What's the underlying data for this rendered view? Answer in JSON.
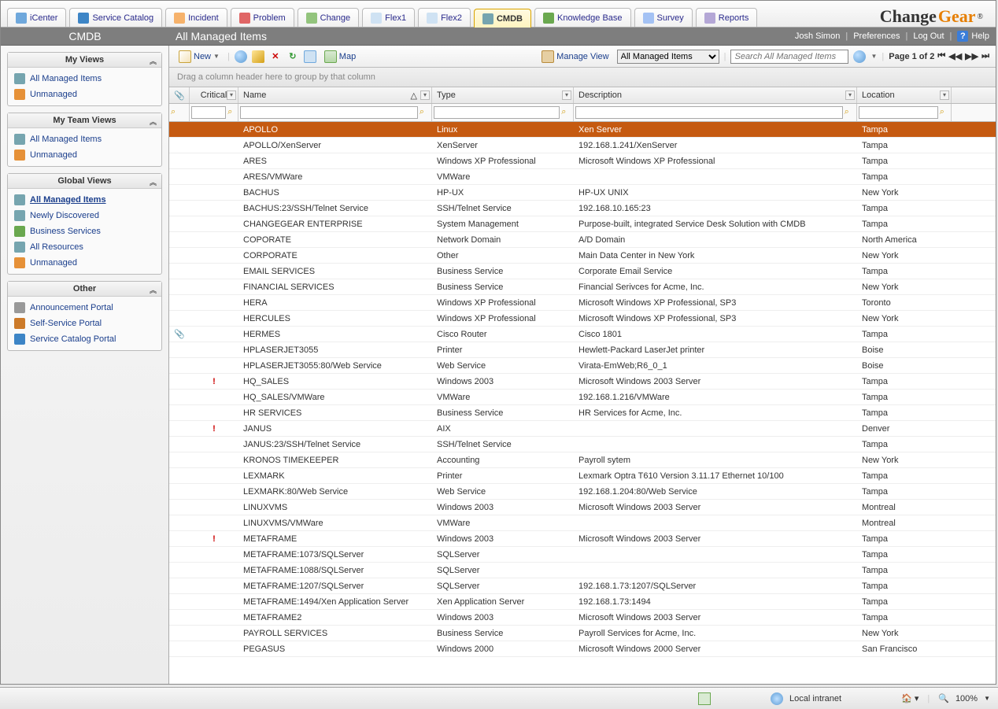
{
  "brand": {
    "name1": "Change",
    "name2": "Gear"
  },
  "tabs": [
    {
      "label": "iCenter",
      "icon": "#6fa8dc"
    },
    {
      "label": "Service Catalog",
      "icon": "#3d85c6"
    },
    {
      "label": "Incident",
      "icon": "#f6b26b"
    },
    {
      "label": "Problem",
      "icon": "#e06666"
    },
    {
      "label": "Change",
      "icon": "#93c47d"
    },
    {
      "label": "Flex1",
      "icon": "#cfe2f3"
    },
    {
      "label": "Flex2",
      "icon": "#cfe2f3"
    },
    {
      "label": "CMDB",
      "icon": "#76a5af",
      "active": true
    },
    {
      "label": "Knowledge Base",
      "icon": "#6aa84f"
    },
    {
      "label": "Survey",
      "icon": "#a4c2f4"
    },
    {
      "label": "Reports",
      "icon": "#b4a7d6"
    }
  ],
  "subheader": {
    "section": "CMDB",
    "title": "All Managed Items"
  },
  "userbar": {
    "user": "Josh Simon",
    "prefs": "Preferences",
    "logout": "Log Out",
    "help": "Help"
  },
  "sidebar": [
    {
      "title": "My Views",
      "items": [
        {
          "label": "All Managed Items",
          "icon": "#76a5af"
        },
        {
          "label": "Unmanaged",
          "icon": "#e69138"
        }
      ]
    },
    {
      "title": "My Team Views",
      "items": [
        {
          "label": "All Managed Items",
          "icon": "#76a5af"
        },
        {
          "label": "Unmanaged",
          "icon": "#e69138"
        }
      ]
    },
    {
      "title": "Global Views",
      "items": [
        {
          "label": "All Managed Items",
          "icon": "#76a5af",
          "active": true
        },
        {
          "label": "Newly Discovered",
          "icon": "#76a5af"
        },
        {
          "label": "Business Services",
          "icon": "#6aa84f"
        },
        {
          "label": "All Resources",
          "icon": "#76a5af"
        },
        {
          "label": "Unmanaged",
          "icon": "#e69138"
        }
      ]
    },
    {
      "title": "Other",
      "items": [
        {
          "label": "Announcement Portal",
          "icon": "#999"
        },
        {
          "label": "Self-Service Portal",
          "icon": "#cc7a29"
        },
        {
          "label": "Service Catalog Portal",
          "icon": "#3d85c6"
        }
      ]
    }
  ],
  "toolbar": {
    "new": "New",
    "map": "Map",
    "manage": "Manage View",
    "view_select": "All Managed Items",
    "search_placeholder": "Search All Managed Items",
    "page": "Page 1 of 2"
  },
  "groupbar": "Drag a column header here to group by that column",
  "columns": [
    "Critical",
    "Name",
    "Type",
    "Description",
    "Location"
  ],
  "rows": [
    {
      "sel": true,
      "name": "APOLLO",
      "type": "Linux",
      "desc": "Xen Server",
      "loc": "Tampa"
    },
    {
      "name": "APOLLO/XenServer",
      "type": "XenServer",
      "desc": "192.168.1.241/XenServer",
      "loc": "Tampa"
    },
    {
      "name": "ARES",
      "type": "Windows XP Professional",
      "desc": "Microsoft Windows XP Professional",
      "loc": "Tampa"
    },
    {
      "name": "ARES/VMWare",
      "type": "VMWare",
      "desc": "",
      "loc": "Tampa"
    },
    {
      "name": "BACHUS",
      "type": "HP-UX",
      "desc": "HP-UX UNIX",
      "loc": "New York"
    },
    {
      "name": "BACHUS:23/SSH/Telnet Service",
      "type": "SSH/Telnet Service",
      "desc": "192.168.10.165:23",
      "loc": "Tampa"
    },
    {
      "name": "CHANGEGEAR ENTERPRISE",
      "type": "System Management",
      "desc": "Purpose-built, integrated Service Desk Solution with CMDB",
      "loc": "Tampa"
    },
    {
      "name": "COPORATE",
      "type": "Network Domain",
      "desc": "A/D Domain",
      "loc": "North America"
    },
    {
      "name": "CORPORATE",
      "type": "Other",
      "desc": "Main Data Center in New York",
      "loc": "New York"
    },
    {
      "name": "EMAIL SERVICES",
      "type": "Business Service",
      "desc": "Corporate Email Service",
      "loc": "Tampa"
    },
    {
      "name": "FINANCIAL SERVICES",
      "type": "Business Service",
      "desc": "Financial Serivces for Acme, Inc.",
      "loc": "New York"
    },
    {
      "name": "HERA",
      "type": "Windows XP Professional",
      "desc": "Microsoft Windows XP Professional, SP3",
      "loc": "Toronto"
    },
    {
      "name": "HERCULES",
      "type": "Windows XP Professional",
      "desc": "Microsoft Windows XP Professional, SP3",
      "loc": "New York"
    },
    {
      "att": true,
      "name": "HERMES",
      "type": "Cisco Router",
      "desc": "Cisco 1801",
      "loc": "Tampa"
    },
    {
      "name": "HPLASERJET3055",
      "type": "Printer",
      "desc": "Hewlett-Packard LaserJet printer",
      "loc": "Boise"
    },
    {
      "name": "HPLASERJET3055:80/Web Service",
      "type": "Web Service",
      "desc": "Virata-EmWeb;R6_0_1",
      "loc": "Boise"
    },
    {
      "crit": true,
      "name": "HQ_SALES",
      "type": "Windows 2003",
      "desc": "Microsoft Windows 2003 Server",
      "loc": "Tampa"
    },
    {
      "name": "HQ_SALES/VMWare",
      "type": "VMWare",
      "desc": "192.168.1.216/VMWare",
      "loc": "Tampa"
    },
    {
      "name": "HR SERVICES",
      "type": "Business Service",
      "desc": "HR Services for Acme, Inc.",
      "loc": "Tampa"
    },
    {
      "crit": true,
      "name": "JANUS",
      "type": "AIX",
      "desc": "",
      "loc": "Denver"
    },
    {
      "name": "JANUS:23/SSH/Telnet Service",
      "type": "SSH/Telnet Service",
      "desc": "",
      "loc": "Tampa"
    },
    {
      "name": "KRONOS TIMEKEEPER",
      "type": "Accounting",
      "desc": "Payroll sytem",
      "loc": "New York"
    },
    {
      "name": "LEXMARK",
      "type": "Printer",
      "desc": "Lexmark Optra T610 Version 3.11.17 Ethernet 10/100",
      "loc": "Tampa"
    },
    {
      "name": "LEXMARK:80/Web Service",
      "type": "Web Service",
      "desc": "192.168.1.204:80/Web Service",
      "loc": "Tampa"
    },
    {
      "name": "LINUXVMS",
      "type": "Windows 2003",
      "desc": "Microsoft Windows 2003 Server",
      "loc": "Montreal"
    },
    {
      "name": "LINUXVMS/VMWare",
      "type": "VMWare",
      "desc": "",
      "loc": "Montreal"
    },
    {
      "crit": true,
      "name": "METAFRAME",
      "type": "Windows 2003",
      "desc": "Microsoft Windows 2003 Server",
      "loc": "Tampa"
    },
    {
      "name": "METAFRAME:1073/SQLServer",
      "type": "SQLServer",
      "desc": "",
      "loc": "Tampa"
    },
    {
      "name": "METAFRAME:1088/SQLServer",
      "type": "SQLServer",
      "desc": "",
      "loc": "Tampa"
    },
    {
      "name": "METAFRAME:1207/SQLServer",
      "type": "SQLServer",
      "desc": "192.168.1.73:1207/SQLServer",
      "loc": "Tampa"
    },
    {
      "name": "METAFRAME:1494/Xen Application Server",
      "type": "Xen Application Server",
      "desc": "192.168.1.73:1494",
      "loc": "Tampa"
    },
    {
      "name": "METAFRAME2",
      "type": "Windows 2003",
      "desc": "Microsoft Windows 2003 Server",
      "loc": "Tampa"
    },
    {
      "name": "PAYROLL SERVICES",
      "type": "Business Service",
      "desc": "Payroll Services for Acme, Inc.",
      "loc": "New York"
    },
    {
      "name": "PEGASUS",
      "type": "Windows 2000",
      "desc": "Microsoft Windows 2000 Server",
      "loc": "San Francisco"
    }
  ],
  "status": {
    "zone": "Local intranet",
    "zoom": "100%"
  }
}
